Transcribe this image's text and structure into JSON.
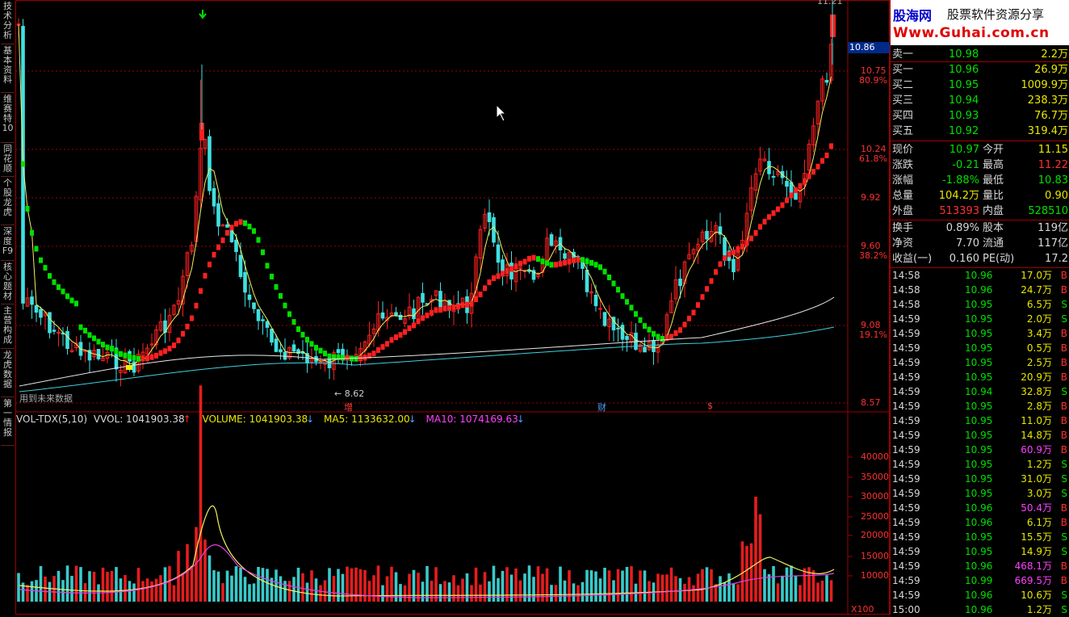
{
  "left_tabs": [
    "技术分析",
    "基本资料",
    "维赛特10",
    "同花顺",
    "个股龙虎",
    "深度F9",
    "核心题材",
    "主营构成",
    "龙虎数据",
    "第一情报"
  ],
  "logo": {
    "brand": "股海网",
    "slogan": "股票软件资源分享",
    "url": "Www.Guhai.com.cn"
  },
  "price_tag": "10.86",
  "top_right_label": "11.21",
  "price_axis": [
    {
      "price": "10.75",
      "pct": "80.9%"
    },
    {
      "price": "10.24",
      "pct": "61.8%"
    },
    {
      "price": "9.92",
      "pct": ""
    },
    {
      "price": "9.60",
      "pct": "38.2%"
    },
    {
      "price": "9.08",
      "pct": "19.1%"
    },
    {
      "price": "8.57",
      "pct": ""
    }
  ],
  "low_marker": "8.62",
  "future_note": "用到未来数据",
  "event_marks": {
    "zeng": "增",
    "cai": "财",
    "s": "$"
  },
  "volume_indicator": {
    "name": "VOL-TDX(5,10)",
    "vvol": "VVOL: 1041903.38",
    "volume": "VOLUME: 1041903.38",
    "ma5": "MA5: 1133632.00",
    "ma10": "MA10: 1074169.63"
  },
  "volume_axis": [
    "40000",
    "35000",
    "30000",
    "25000",
    "20000",
    "15000",
    "10000"
  ],
  "volume_unit": "X100",
  "watermark": "用到未来数据——股海网",
  "order_book": [
    {
      "label": "卖一",
      "price": "10.98",
      "vol": "2.2万"
    },
    {
      "label": "买一",
      "price": "10.96",
      "vol": "26.9万"
    },
    {
      "label": "买二",
      "price": "10.95",
      "vol": "1009.9万"
    },
    {
      "label": "买三",
      "price": "10.94",
      "vol": "238.3万"
    },
    {
      "label": "买四",
      "price": "10.93",
      "vol": "76.7万"
    },
    {
      "label": "买五",
      "price": "10.92",
      "vol": "319.4万"
    }
  ],
  "stats": [
    {
      "l1": "现价",
      "v1": "10.97",
      "l2": "今开",
      "v2": "11.15"
    },
    {
      "l1": "涨跌",
      "v1": "-0.21",
      "l2": "最高",
      "v2": "11.22"
    },
    {
      "l1": "涨幅",
      "v1": "-1.88%",
      "l2": "最低",
      "v2": "10.83"
    },
    {
      "l1": "总量",
      "v1": "104.2万",
      "l2": "量比",
      "v2": "0.90"
    },
    {
      "l1": "外盘",
      "v1": "513393",
      "l2": "内盘",
      "v2": "528510"
    }
  ],
  "stats2": [
    {
      "l1": "换手",
      "v1": "0.89%",
      "l2": "股本",
      "v2": "119亿"
    },
    {
      "l1": "净资",
      "v1": "7.70",
      "l2": "流通",
      "v2": "117亿"
    },
    {
      "l1": "收益(一)",
      "v1": "0.160",
      "l2": "PE(动)",
      "v2": "17.2"
    }
  ],
  "ticks": [
    {
      "t": "14:58",
      "p": "10.96",
      "v": "17.0万",
      "s": "B"
    },
    {
      "t": "14:58",
      "p": "10.96",
      "v": "24.7万",
      "s": "B"
    },
    {
      "t": "14:58",
      "p": "10.95",
      "v": "6.5万",
      "s": "S"
    },
    {
      "t": "14:59",
      "p": "10.95",
      "v": "2.0万",
      "s": "S"
    },
    {
      "t": "14:59",
      "p": "10.95",
      "v": "3.4万",
      "s": "B"
    },
    {
      "t": "14:59",
      "p": "10.95",
      "v": "0.5万",
      "s": "B"
    },
    {
      "t": "14:59",
      "p": "10.95",
      "v": "2.5万",
      "s": "B"
    },
    {
      "t": "14:59",
      "p": "10.95",
      "v": "20.9万",
      "s": "B"
    },
    {
      "t": "14:59",
      "p": "10.94",
      "v": "32.8万",
      "s": "S"
    },
    {
      "t": "14:59",
      "p": "10.95",
      "v": "2.8万",
      "s": "B"
    },
    {
      "t": "14:59",
      "p": "10.95",
      "v": "11.0万",
      "s": "B"
    },
    {
      "t": "14:59",
      "p": "10.95",
      "v": "14.8万",
      "s": "B"
    },
    {
      "t": "14:59",
      "p": "10.95",
      "v": "60.9万",
      "s": "B"
    },
    {
      "t": "14:59",
      "p": "10.95",
      "v": "1.2万",
      "s": "S"
    },
    {
      "t": "14:59",
      "p": "10.95",
      "v": "31.0万",
      "s": "S"
    },
    {
      "t": "14:59",
      "p": "10.95",
      "v": "3.0万",
      "s": "S"
    },
    {
      "t": "14:59",
      "p": "10.96",
      "v": "50.4万",
      "s": "B"
    },
    {
      "t": "14:59",
      "p": "10.96",
      "v": "6.1万",
      "s": "B"
    },
    {
      "t": "14:59",
      "p": "10.95",
      "v": "15.5万",
      "s": "S"
    },
    {
      "t": "14:59",
      "p": "10.95",
      "v": "14.9万",
      "s": "S"
    },
    {
      "t": "14:59",
      "p": "10.96",
      "v": "468.1万",
      "s": "B"
    },
    {
      "t": "14:59",
      "p": "10.99",
      "v": "669.5万",
      "s": "B"
    },
    {
      "t": "14:59",
      "p": "10.96",
      "v": "10.6万",
      "s": "S"
    },
    {
      "t": "15:00",
      "p": "10.96",
      "v": "1.2万",
      "s": "S"
    }
  ],
  "colors": {
    "up": "#ff2020",
    "down": "#40e0e0",
    "ma_yellow": "#f0f060",
    "ma_white": "#e8e8e8",
    "ma_cyan": "#40d0e0",
    "band_green": "#00e000",
    "grid": "#a00000",
    "magenta": "#e040e0"
  }
}
